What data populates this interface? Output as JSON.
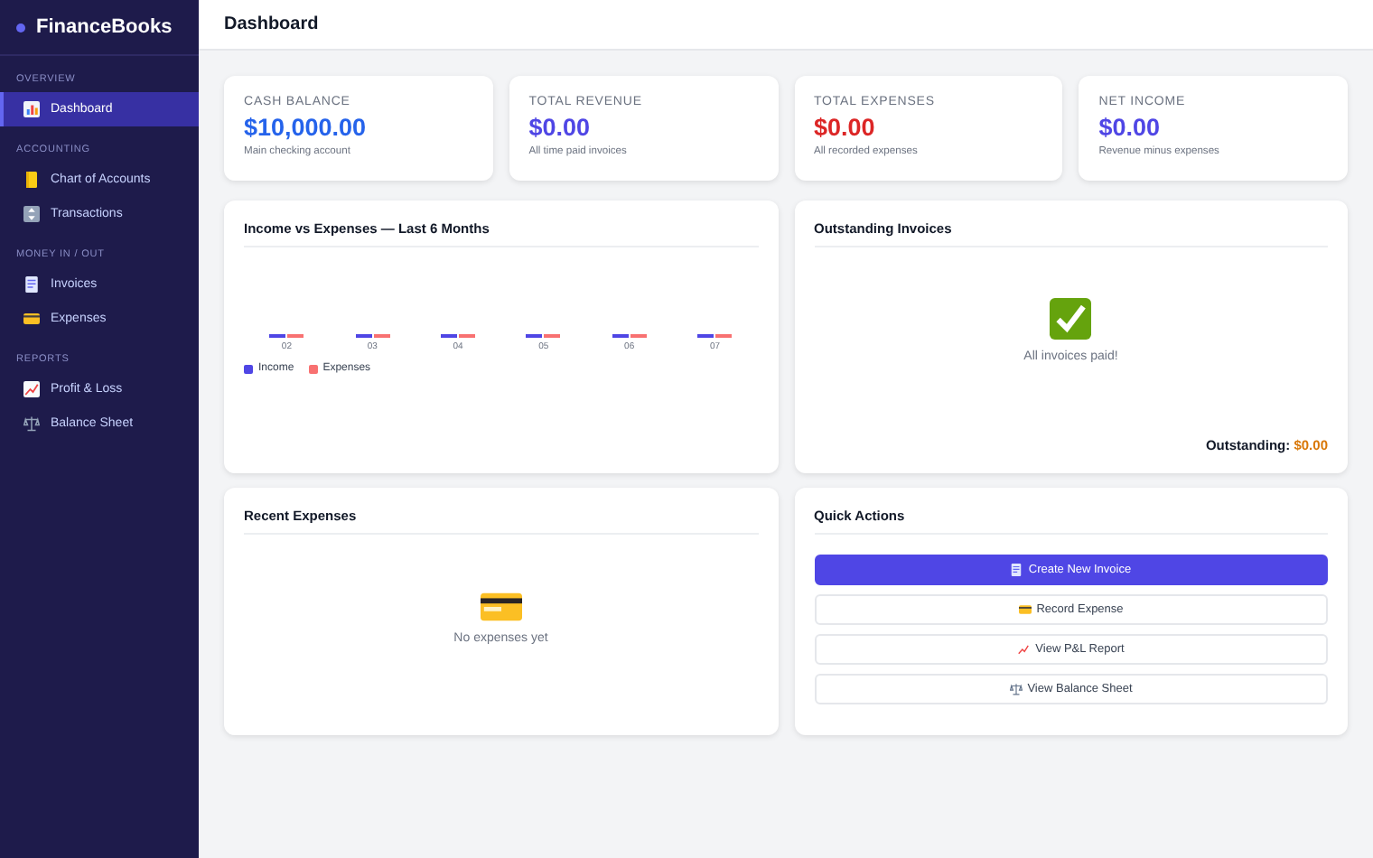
{
  "app": {
    "name": "FinanceBooks"
  },
  "sidebar": {
    "sections": [
      {
        "title": "OVERVIEW",
        "items": [
          {
            "label": "Dashboard",
            "selected": true
          }
        ]
      },
      {
        "title": "ACCOUNTING",
        "items": [
          {
            "label": "Chart of Accounts",
            "selected": false
          },
          {
            "label": "Transactions",
            "selected": false
          }
        ]
      },
      {
        "title": "MONEY IN / OUT",
        "items": [
          {
            "label": "Invoices",
            "selected": false
          },
          {
            "label": "Expenses",
            "selected": false
          }
        ]
      },
      {
        "title": "REPORTS",
        "items": [
          {
            "label": "Profit & Loss",
            "selected": false
          },
          {
            "label": "Balance Sheet",
            "selected": false
          }
        ]
      }
    ]
  },
  "header": {
    "title": "Dashboard"
  },
  "stats": [
    {
      "label": "CASH BALANCE",
      "value": "$10,000.00",
      "note": "Main checking account",
      "color": "#2563eb"
    },
    {
      "label": "TOTAL REVENUE",
      "value": "$0.00",
      "note": "All time paid invoices",
      "color": "#4f46e5"
    },
    {
      "label": "TOTAL EXPENSES",
      "value": "$0.00",
      "note": "All recorded expenses",
      "color": "#dc2626"
    },
    {
      "label": "NET INCOME",
      "value": "$0.00",
      "note": "Revenue minus expenses",
      "color": "#4f46e5"
    }
  ],
  "income_chart": {
    "title": "Income vs Expenses — Last 6 Months",
    "months": [
      "02",
      "03",
      "04",
      "05",
      "06",
      "07"
    ],
    "legend": [
      {
        "name": "Income",
        "color": "#4f46e5"
      },
      {
        "name": "Expenses",
        "color": "#f87171"
      }
    ]
  },
  "outstanding": {
    "title": "Outstanding Invoices",
    "message": "All invoices paid!",
    "total_label": "Outstanding:",
    "total": "$0.00"
  },
  "recent_expenses": {
    "title": "Recent Expenses",
    "message": "No expenses yet"
  },
  "quick_actions": {
    "title": "Quick Actions",
    "buttons": [
      {
        "label": "Create New Invoice",
        "kind": "primary"
      },
      {
        "label": "Record Expense",
        "kind": "secondary"
      },
      {
        "label": "View P&L Report",
        "kind": "secondary"
      },
      {
        "label": "View Balance Sheet",
        "kind": "secondary"
      }
    ]
  }
}
